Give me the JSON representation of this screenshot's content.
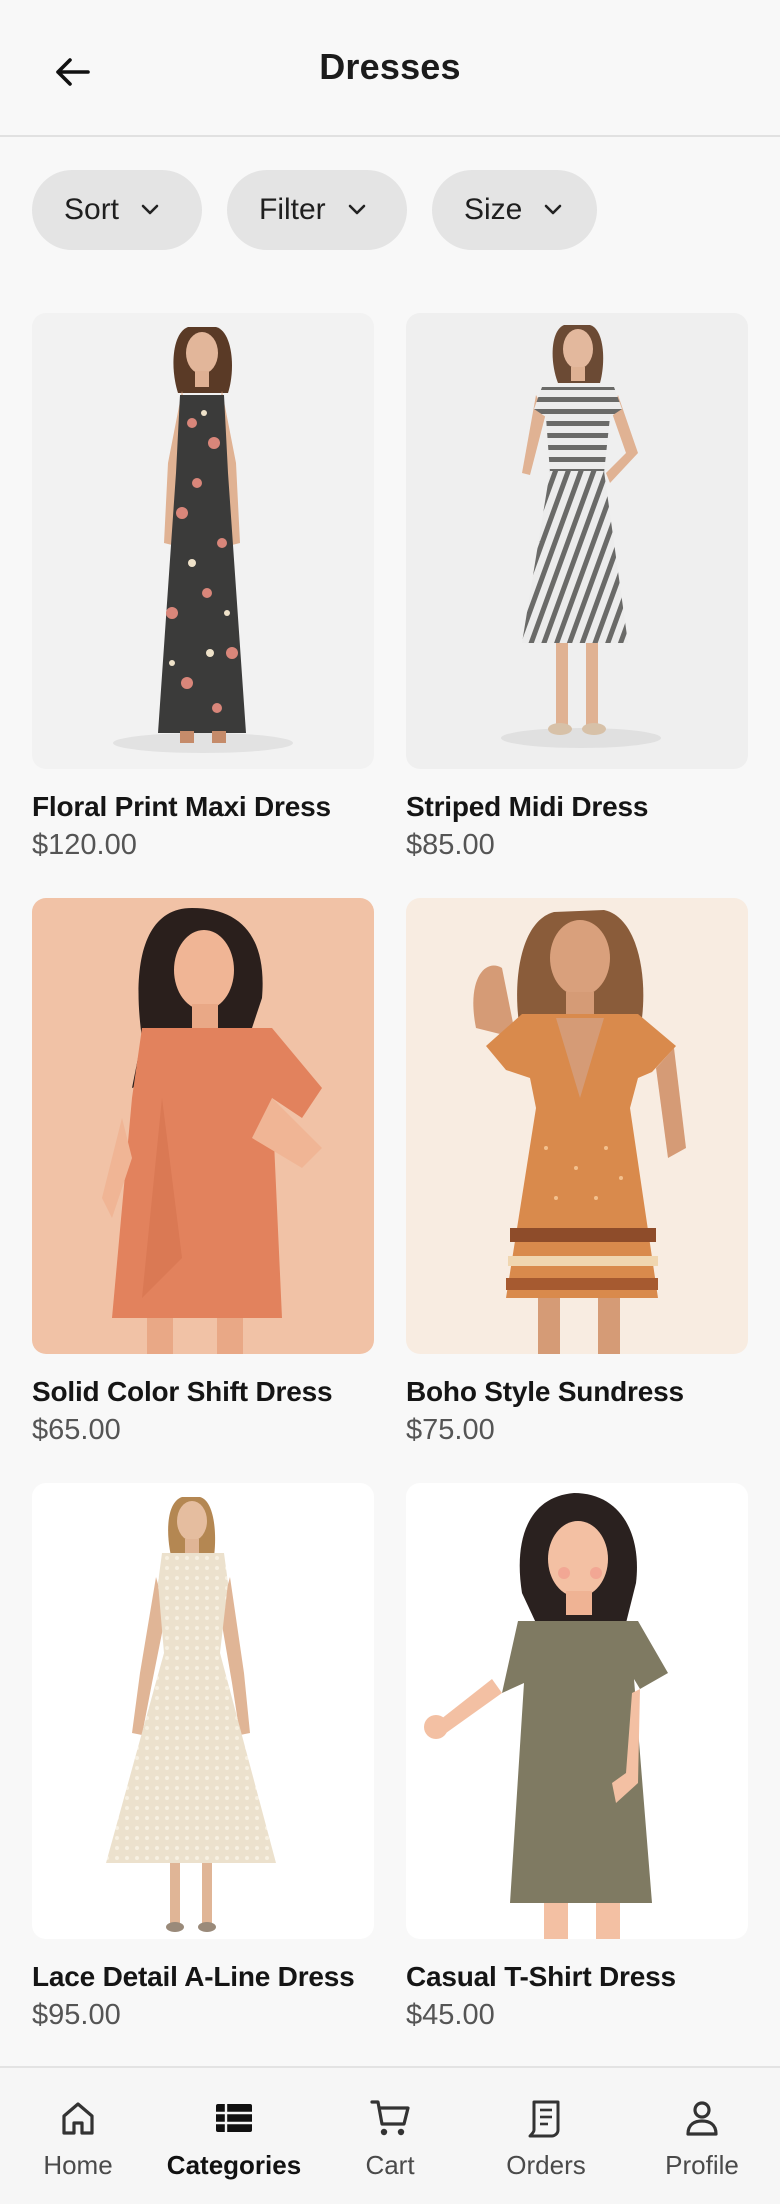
{
  "header": {
    "title": "Dresses",
    "back_icon": "arrow-left-icon"
  },
  "filters": [
    {
      "label": "Sort"
    },
    {
      "label": "Filter"
    },
    {
      "label": "Size"
    }
  ],
  "products": [
    {
      "name": "Floral Print Maxi Dress",
      "price": "$120.00",
      "image": "woman in dark floral maxi dress"
    },
    {
      "name": "Striped Midi Dress",
      "price": "$85.00",
      "image": "woman in striped midi dress"
    },
    {
      "name": "Solid Color Shift Dress",
      "price": "$65.00",
      "image": "illustrated woman in coral shift dress"
    },
    {
      "name": "Boho Style Sundress",
      "price": "$75.00",
      "image": "woman in orange boho sundress"
    },
    {
      "name": "Lace Detail A-Line Dress",
      "price": "$95.00",
      "image": "woman in cream lace a-line dress"
    },
    {
      "name": "Casual T-Shirt Dress",
      "price": "$45.00",
      "image": "illustrated woman in olive t-shirt dress"
    }
  ],
  "nav": {
    "active": "Categories",
    "items": [
      {
        "label": "Home",
        "icon": "home-icon"
      },
      {
        "label": "Categories",
        "icon": "list-grid-icon"
      },
      {
        "label": "Cart",
        "icon": "cart-icon"
      },
      {
        "label": "Orders",
        "icon": "receipt-icon"
      },
      {
        "label": "Profile",
        "icon": "person-icon"
      }
    ]
  }
}
